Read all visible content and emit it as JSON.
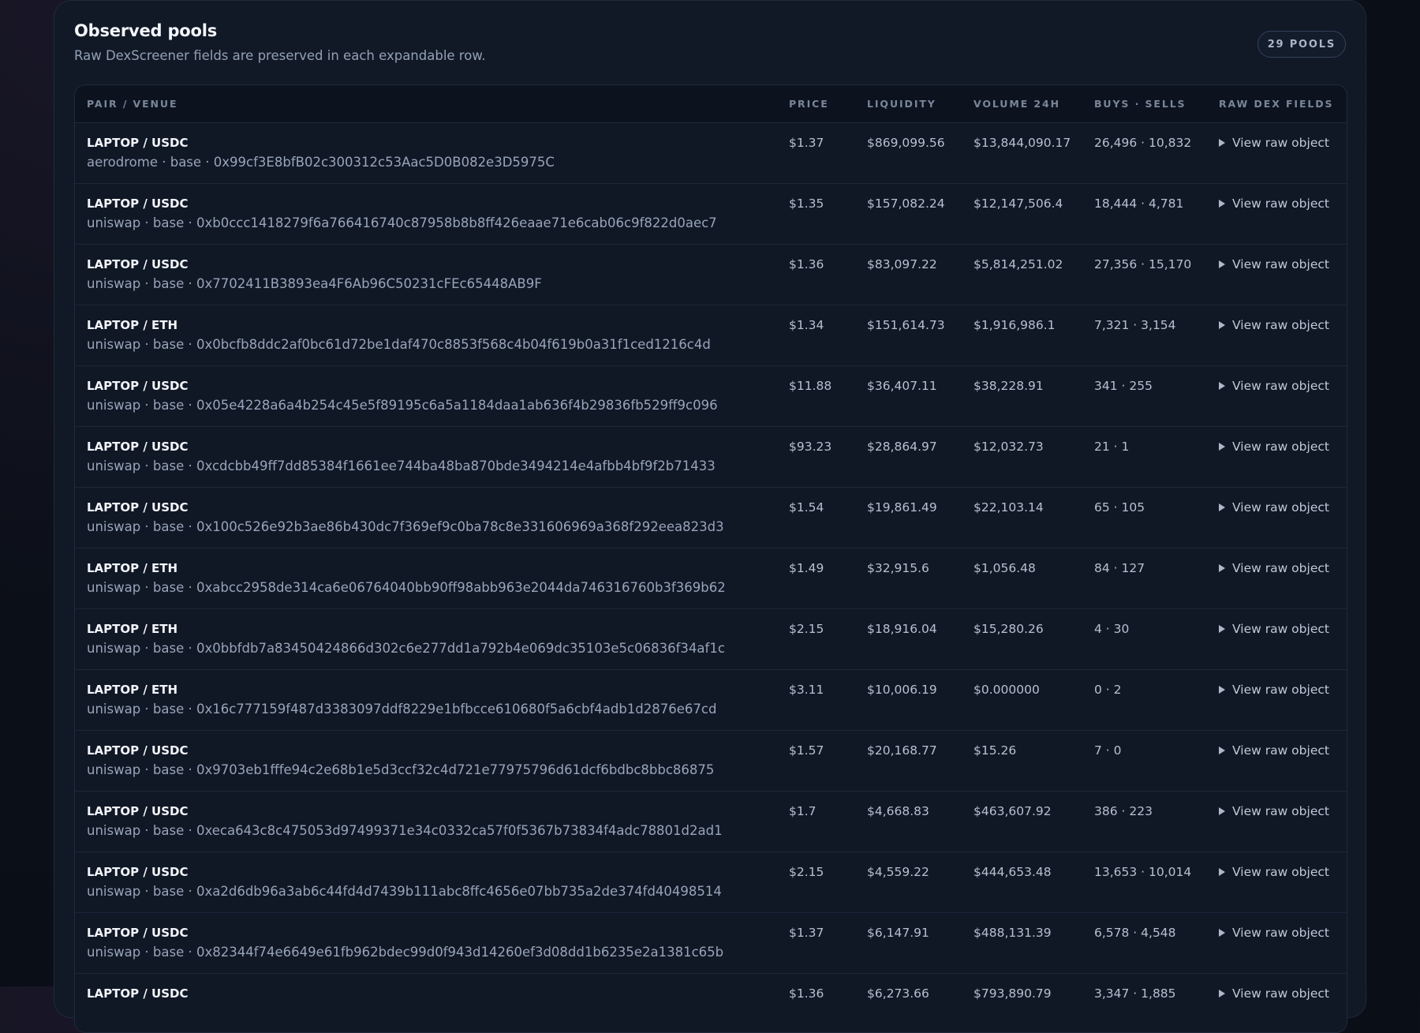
{
  "panel": {
    "title": "Observed pools",
    "subtitle": "Raw DexScreener fields are preserved in each expandable row.",
    "count_badge": "29 POOLS"
  },
  "table": {
    "headers": {
      "pair": "PAIR / VENUE",
      "price": "PRICE",
      "liquidity": "LIQUIDITY",
      "volume": "VOLUME 24H",
      "buys_sells": "BUYS · SELLS",
      "raw": "RAW DEX FIELDS"
    },
    "raw_link_label": "View raw object",
    "rows": [
      {
        "pair": "LAPTOP / USDC",
        "venue": "aerodrome · base · 0x99cf3E8bfB02c300312c53Aac5D0B082e3D5975C",
        "price": "$1.37",
        "liquidity": "$869,099.56",
        "volume": "$13,844,090.17",
        "buys_sells": "26,496 · 10,832",
        "raw": "View raw object"
      },
      {
        "pair": "LAPTOP / USDC",
        "venue": "uniswap · base · 0xb0ccc1418279f6a766416740c87958b8b8ff426eaae71e6cab06c9f822d0aec7",
        "price": "$1.35",
        "liquidity": "$157,082.24",
        "volume": "$12,147,506.4",
        "buys_sells": "18,444 · 4,781",
        "raw": "View raw object"
      },
      {
        "pair": "LAPTOP / USDC",
        "venue": "uniswap · base · 0x7702411B3893ea4F6Ab96C50231cFEc65448AB9F",
        "price": "$1.36",
        "liquidity": "$83,097.22",
        "volume": "$5,814,251.02",
        "buys_sells": "27,356 · 15,170",
        "raw": "View raw object"
      },
      {
        "pair": "LAPTOP / ETH",
        "venue": "uniswap · base · 0x0bcfb8ddc2af0bc61d72be1daf470c8853f568c4b04f619b0a31f1ced1216c4d",
        "price": "$1.34",
        "liquidity": "$151,614.73",
        "volume": "$1,916,986.1",
        "buys_sells": "7,321 · 3,154",
        "raw": "View raw object"
      },
      {
        "pair": "LAPTOP / USDC",
        "venue": "uniswap · base · 0x05e4228a6a4b254c45e5f89195c6a5a1184daa1ab636f4b29836fb529ff9c096",
        "price": "$11.88",
        "liquidity": "$36,407.11",
        "volume": "$38,228.91",
        "buys_sells": "341 · 255",
        "raw": "View raw object"
      },
      {
        "pair": "LAPTOP / USDC",
        "venue": "uniswap · base · 0xcdcbb49ff7dd85384f1661ee744ba48ba870bde3494214e4afbb4bf9f2b71433",
        "price": "$93.23",
        "liquidity": "$28,864.97",
        "volume": "$12,032.73",
        "buys_sells": "21 · 1",
        "raw": "View raw object"
      },
      {
        "pair": "LAPTOP / USDC",
        "venue": "uniswap · base · 0x100c526e92b3ae86b430dc7f369ef9c0ba78c8e331606969a368f292eea823d3",
        "price": "$1.54",
        "liquidity": "$19,861.49",
        "volume": "$22,103.14",
        "buys_sells": "65 · 105",
        "raw": "View raw object"
      },
      {
        "pair": "LAPTOP / ETH",
        "venue": "uniswap · base · 0xabcc2958de314ca6e06764040bb90ff98abb963e2044da746316760b3f369b62",
        "price": "$1.49",
        "liquidity": "$32,915.6",
        "volume": "$1,056.48",
        "buys_sells": "84 · 127",
        "raw": "View raw object"
      },
      {
        "pair": "LAPTOP / ETH",
        "venue": "uniswap · base · 0x0bbfdb7a83450424866d302c6e277dd1a792b4e069dc35103e5c06836f34af1c",
        "price": "$2.15",
        "liquidity": "$18,916.04",
        "volume": "$15,280.26",
        "buys_sells": "4 · 30",
        "raw": "View raw object"
      },
      {
        "pair": "LAPTOP / ETH",
        "venue": "uniswap · base · 0x16c777159f487d3383097ddf8229e1bfbcce610680f5a6cbf4adb1d2876e67cd",
        "price": "$3.11",
        "liquidity": "$10,006.19",
        "volume": "$0.000000",
        "buys_sells": "0 · 2",
        "raw": "View raw object"
      },
      {
        "pair": "LAPTOP / USDC",
        "venue": "uniswap · base · 0x9703eb1fffe94c2e68b1e5d3ccf32c4d721e77975796d61dcf6bdbc8bbc86875",
        "price": "$1.57",
        "liquidity": "$20,168.77",
        "volume": "$15.26",
        "buys_sells": "7 · 0",
        "raw": "View raw object"
      },
      {
        "pair": "LAPTOP / USDC",
        "venue": "uniswap · base · 0xeca643c8c475053d97499371e34c0332ca57f0f5367b73834f4adc78801d2ad1",
        "price": "$1.7",
        "liquidity": "$4,668.83",
        "volume": "$463,607.92",
        "buys_sells": "386 · 223",
        "raw": "View raw object"
      },
      {
        "pair": "LAPTOP / USDC",
        "venue": "uniswap · base · 0xa2d6db96a3ab6c44fd4d7439b111abc8ffc4656e07bb735a2de374fd40498514",
        "price": "$2.15",
        "liquidity": "$4,559.22",
        "volume": "$444,653.48",
        "buys_sells": "13,653 · 10,014",
        "raw": "View raw object"
      },
      {
        "pair": "LAPTOP / USDC",
        "venue": "uniswap · base · 0x82344f74e6649e61fb962bdec99d0f943d14260ef3d08dd1b6235e2a1381c65b",
        "price": "$1.37",
        "liquidity": "$6,147.91",
        "volume": "$488,131.39",
        "buys_sells": "6,578 · 4,548",
        "raw": "View raw object"
      },
      {
        "pair": "LAPTOP / USDC",
        "venue": "",
        "price": "$1.36",
        "liquidity": "$6,273.66",
        "volume": "$793,890.79",
        "buys_sells": "3,347 · 1,885",
        "raw": "View raw object"
      }
    ]
  }
}
